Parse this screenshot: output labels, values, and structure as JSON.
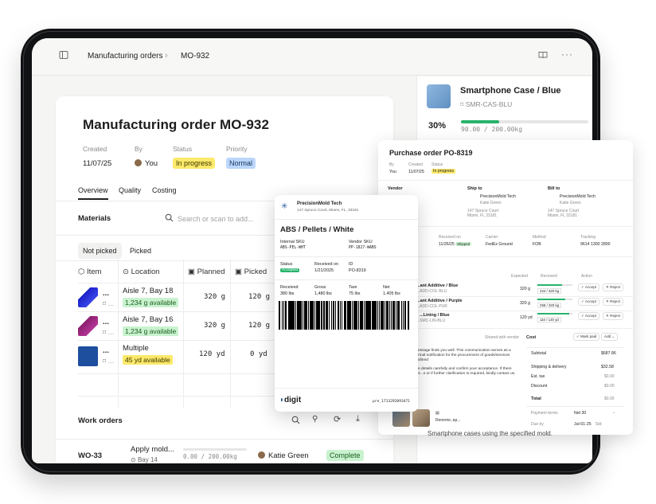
{
  "topbar": {
    "crumb_parent": "Manufacturing orders",
    "crumb_sep": "›",
    "crumb_current": "MO-932"
  },
  "order": {
    "title": "Manufacturing order MO-932",
    "created_label": "Created",
    "created_value": "11/07/25",
    "by_label": "By",
    "by_value": "You",
    "status_label": "Status",
    "status_value": "In progress",
    "priority_label": "Priority",
    "priority_value": "Normal"
  },
  "tabs": [
    "Overview",
    "Quality",
    "Costing"
  ],
  "materials": {
    "title": "Materials",
    "search_placeholder": "Search or scan to add...",
    "subtabs": [
      "Not picked",
      "Picked"
    ],
    "columns": [
      "Item",
      "Location",
      "Planned",
      "Picked"
    ],
    "rows": [
      {
        "item": "...",
        "location": "Aisle 7, Bay 18",
        "available": "1,234 g available",
        "planned": "320 g",
        "picked": "120 g"
      },
      {
        "item": "...",
        "location": "Aisle 7, Bay 16",
        "available": "1,234 g available",
        "planned": "320 g",
        "picked": "120 g"
      },
      {
        "item": "...",
        "location": "Multiple",
        "available": "45 yd available",
        "planned": "120 yd",
        "picked": "0 yd"
      }
    ]
  },
  "work_orders": {
    "title": "Work orders",
    "row": {
      "id": "WO-33",
      "name": "Apply mold...",
      "location": "Bay 14",
      "qty": "0.00 / 200.00kg",
      "assignee": "Katie Green",
      "status": "Complete"
    }
  },
  "product": {
    "title": "Smartphone Case / Blue",
    "sku": "SMR-CAS-BLU",
    "percent": "30%",
    "progress": 0.3,
    "qty": "90.00 / 200.00kg"
  },
  "purchase_order": {
    "title": "Purchase order PO-8319",
    "by_label": "By",
    "by_value": "You",
    "created_label": "Created",
    "created_value": "11/07/25",
    "status_label": "Status",
    "status_value": "In progress",
    "vendor_label": "Vendor",
    "ship_to_label": "Ship to",
    "bill_to_label": "Bill to",
    "ship_to_name": "PrecisionMold Tech",
    "ship_to_contact": "Katie Green",
    "ship_to_addr1": "147 Spruce Court",
    "ship_to_addr2": "Miami, FL 33181",
    "bill_to_name": "PrecisionMold Tech",
    "bill_to_contact": "Katie Green",
    "bill_to_addr1": "147 Spruce Court",
    "bill_to_addr2": "Miami, FL 33181",
    "received_on_label": "Received on",
    "received_on_value": "11/26/25",
    "received_badge": "Shipped",
    "carrier_label": "Carrier",
    "carrier_value": "FedEx Ground",
    "method_label": "Method",
    "method_value": "FOB",
    "tracking_label": "Tracking",
    "tracking_value": "9614 1300 2800",
    "expected_label": "Expected",
    "received_label": "Received",
    "action_label": "Action",
    "lines": [
      {
        "name": "...ant Additive / Blue",
        "sku": "...ADD-COL-BLU",
        "expected": "320 g",
        "received": "224 / 320 kg",
        "progress": 0.7
      },
      {
        "name": "...ant Additive / Purple",
        "sku": "...ADD-COL-PUR",
        "expected": "320 g",
        "received": "258 / 320 kg",
        "progress": 0.8
      },
      {
        "name": "...Lining / Blue",
        "sku": "...SMC-LIN-BLU",
        "expected": "120 yd",
        "received": "110 / 120 yd",
        "progress": 0.92
      }
    ],
    "accept_label": "Accept",
    "reject_label": "Reject",
    "cost_label": "Cost",
    "shared_label": "Shared with vendor",
    "mark_paid_label": "Mark paid",
    "add_label": "Add",
    "message_1": "...essage finds you well. This communication serves as a formal notification for the procurement of goods/services outlined",
    "message_2": "...e details carefully and confirm your acceptance. If there are...s or if further clarification is required, kindly contact us.",
    "attachment_name": "Reneme..ap...",
    "summary": [
      {
        "label": "Subtotal",
        "value": "$687.86"
      },
      {
        "label": "Shipping & delivery",
        "value": "$32.58"
      },
      {
        "label": "Est. tax",
        "value": "$0.00"
      },
      {
        "label": "Discount",
        "value": "$0.00"
      },
      {
        "label": "Total",
        "value": "$0.00"
      }
    ],
    "payment_terms_label": "Payment terms",
    "payment_terms_value": "Net 30",
    "due_label": "Due by",
    "due_value": "Jul-01-25",
    "due_note": "Std"
  },
  "label": {
    "company": "PrecisionMold Tech",
    "address": "147 Spruce Court, Miami, FL, 33181",
    "product": "ABS / Pellets / White",
    "internal_sku_label": "Internal SKU",
    "internal_sku": "ABS-PEL-WHT",
    "vendor_sku_label": "Vendor SKU",
    "vendor_sku": "PP-1827-WABS",
    "status_label": "Status",
    "status": "Accepted",
    "received_on_label": "Received on",
    "received_on": "1/21/2025",
    "id_label": "ID",
    "id": "PO-8319",
    "received_label": "Received",
    "received": "380 lbs",
    "gross_label": "Gross",
    "gross": "1,480 lbs",
    "tare_label": "Tare",
    "tare": "75 lbs",
    "net_label": "Net",
    "net": "1,405 lbs",
    "brand": "digit",
    "code": "pre_1713292093471"
  },
  "colors": {
    "accent_green": "#27b36b",
    "status_yellow": "#fbe96a",
    "status_blue": "#bcd6fb",
    "status_green": "#c9f2cf"
  },
  "behind_text": "Smartphone cases using the specified mold."
}
